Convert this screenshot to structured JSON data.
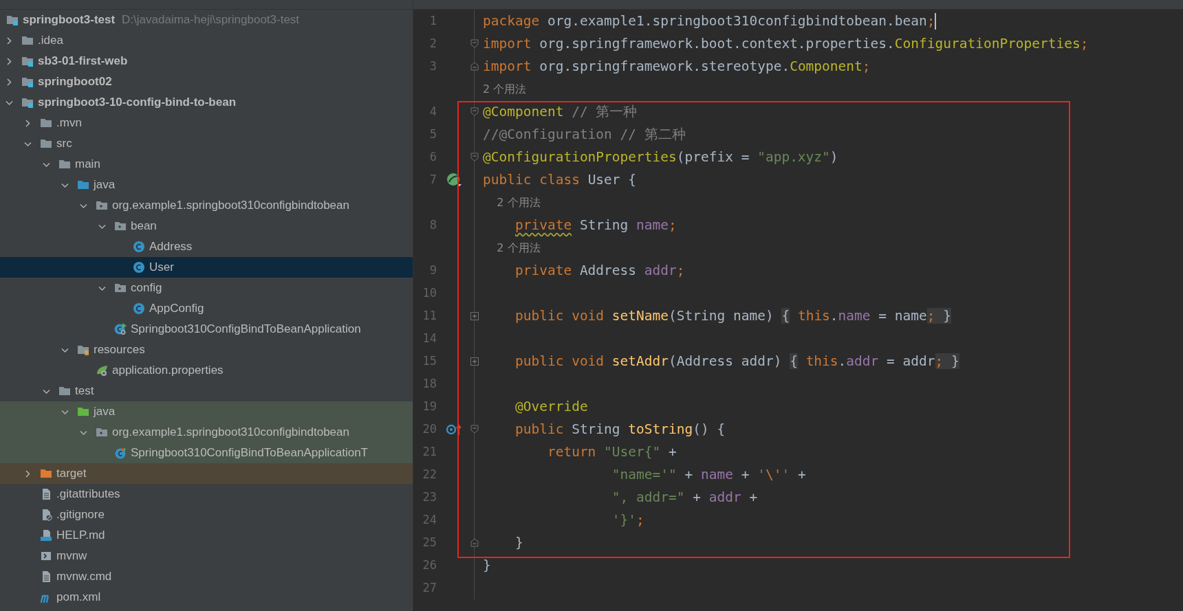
{
  "project_tree": {
    "label": "springboot3-test",
    "path": "D:\\javadaima-heji\\springboot3-test",
    "selected": false,
    "children": [
      {
        "label": ".idea",
        "kind": "folder",
        "expanded": false,
        "selected": false
      },
      {
        "label": "sb3-01-first-web",
        "kind": "module",
        "expanded": false,
        "selected": false
      },
      {
        "label": "springboot02",
        "kind": "module",
        "expanded": false,
        "selected": false
      },
      {
        "label": "springboot3-10-config-bind-to-bean",
        "kind": "module",
        "expanded": true,
        "selected": false,
        "children": [
          {
            "label": ".mvn",
            "kind": "folder",
            "expanded": false,
            "selected": false
          },
          {
            "label": "src",
            "kind": "folder",
            "expanded": true,
            "selected": false,
            "children": [
              {
                "label": "main",
                "kind": "folder",
                "expanded": true,
                "selected": false,
                "children": [
                  {
                    "label": "java",
                    "kind": "source",
                    "expanded": true,
                    "selected": false,
                    "children": [
                      {
                        "label": "org.example1.springboot310configbindtobean",
                        "kind": "package",
                        "expanded": true,
                        "selected": false,
                        "children": [
                          {
                            "label": "bean",
                            "kind": "package",
                            "expanded": true,
                            "selected": false,
                            "children": [
                              {
                                "label": "Address",
                                "kind": "class",
                                "selected": false
                              },
                              {
                                "label": "User",
                                "kind": "class",
                                "selected": true
                              }
                            ]
                          },
                          {
                            "label": "config",
                            "kind": "package",
                            "expanded": true,
                            "selected": false,
                            "children": [
                              {
                                "label": "AppConfig",
                                "kind": "class",
                                "selected": false
                              }
                            ]
                          },
                          {
                            "label": "Springboot310ConfigBindToBeanApplication",
                            "kind": "app",
                            "selected": false
                          }
                        ]
                      }
                    ]
                  },
                  {
                    "label": "resources",
                    "kind": "resources",
                    "expanded": true,
                    "selected": false,
                    "children": [
                      {
                        "label": "application.properties",
                        "kind": "properties",
                        "selected": false
                      }
                    ]
                  }
                ]
              },
              {
                "label": "test",
                "kind": "folder",
                "expanded": true,
                "selected": false,
                "children": [
                  {
                    "label": "java",
                    "kind": "test-source",
                    "test_scope": true,
                    "expanded": true,
                    "selected": false,
                    "children": [
                      {
                        "label": "org.example1.springboot310configbindtobean",
                        "kind": "package",
                        "test_scope": true,
                        "expanded": true,
                        "selected": false,
                        "children": [
                          {
                            "label": "Springboot310ConfigBindToBeanApplicationT",
                            "kind": "test-class",
                            "test_scope": true,
                            "selected": false
                          }
                        ]
                      }
                    ]
                  }
                ]
              }
            ]
          },
          {
            "label": "target",
            "kind": "target",
            "excluded": true,
            "expanded": false,
            "selected": false
          },
          {
            "label": ".gitattributes",
            "kind": "text",
            "selected": false
          },
          {
            "label": ".gitignore",
            "kind": "ignore",
            "selected": false
          },
          {
            "label": "HELP.md",
            "kind": "markdown",
            "selected": false
          },
          {
            "label": "mvnw",
            "kind": "script",
            "selected": false
          },
          {
            "label": "mvnw.cmd",
            "kind": "text",
            "selected": false
          },
          {
            "label": "pom.xml",
            "kind": "maven",
            "selected": false
          }
        ]
      }
    ]
  },
  "editor": {
    "lines": [
      {
        "kind": "code",
        "number": "1",
        "caret": true,
        "tokens": [
          {
            "kind": "kw",
            "text": "package"
          },
          {
            "kind": "plain",
            "text": " org.example1.springboot310configbindtobean.bean"
          },
          {
            "kind": "kw",
            "text": ";"
          }
        ]
      },
      {
        "kind": "code",
        "number": "2",
        "fold": {
          "kind": "open"
        },
        "tokens": [
          {
            "kind": "kw",
            "text": "import"
          },
          {
            "kind": "plain",
            "text": " org.springframework.boot.context.properties."
          },
          {
            "kind": "ann",
            "text": "ConfigurationProperties"
          },
          {
            "kind": "kw",
            "text": ";"
          }
        ]
      },
      {
        "kind": "code",
        "number": "3",
        "fold": {
          "kind": "end"
        },
        "tokens": [
          {
            "kind": "kw",
            "text": "import"
          },
          {
            "kind": "plain",
            "text": " org.springframework.stereotype."
          },
          {
            "kind": "ann",
            "text": "Component"
          },
          {
            "kind": "kw",
            "text": ";"
          }
        ]
      },
      {
        "kind": "hint",
        "text": "2 个用法"
      },
      {
        "kind": "code",
        "number": "4",
        "fold": {
          "kind": "open"
        },
        "tokens": [
          {
            "kind": "ann",
            "text": "@Component"
          },
          {
            "kind": "comment",
            "text": " // 第一种"
          }
        ]
      },
      {
        "kind": "code",
        "number": "5",
        "tokens": [
          {
            "kind": "comment",
            "text": "//@Configuration // 第二种"
          }
        ]
      },
      {
        "kind": "code",
        "number": "6",
        "fold": {
          "kind": "open"
        },
        "tokens": [
          {
            "kind": "ann",
            "text": "@ConfigurationProperties"
          },
          {
            "kind": "plain",
            "text": "(prefix = "
          },
          {
            "kind": "str",
            "text": "\"app.xyz\""
          },
          {
            "kind": "plain",
            "text": ")"
          }
        ]
      },
      {
        "kind": "code",
        "number": "7",
        "marker": {
          "kind": "bean"
        },
        "tokens": [
          {
            "kind": "kw",
            "text": "public class "
          },
          {
            "kind": "plain",
            "text": "User {"
          }
        ]
      },
      {
        "kind": "hint",
        "text": "    2 个用法"
      },
      {
        "kind": "code",
        "number": "8",
        "tokens": [
          {
            "kind": "kw-warn",
            "text": "    private"
          },
          {
            "kind": "plain",
            "text": " String "
          },
          {
            "kind": "field",
            "text": "name"
          },
          {
            "kind": "kw",
            "text": ";"
          }
        ]
      },
      {
        "kind": "hint",
        "text": "    2 个用法"
      },
      {
        "kind": "code",
        "number": "9",
        "tokens": [
          {
            "kind": "kw",
            "text": "    private"
          },
          {
            "kind": "plain",
            "text": " Address "
          },
          {
            "kind": "field",
            "text": "addr"
          },
          {
            "kind": "kw",
            "text": ";"
          }
        ]
      },
      {
        "kind": "code",
        "number": "10"
      },
      {
        "kind": "code",
        "number": "11",
        "fold": {
          "kind": "collapsed"
        },
        "tokens": [
          {
            "kind": "kw",
            "text": "    public void "
          },
          {
            "kind": "method",
            "text": "setName"
          },
          {
            "kind": "plain",
            "text": "(String name) "
          },
          {
            "kind": "fold",
            "text": "{"
          },
          {
            "kind": "kw",
            "text": " this"
          },
          {
            "kind": "plain",
            "text": "."
          },
          {
            "kind": "field",
            "text": "name"
          },
          {
            "kind": "plain",
            "text": " = name"
          },
          {
            "kind": "fold-kw",
            "text": ";"
          },
          {
            "kind": "fold",
            "text": " }"
          }
        ]
      },
      {
        "kind": "code",
        "number": "14"
      },
      {
        "kind": "code",
        "number": "15",
        "fold": {
          "kind": "collapsed"
        },
        "tokens": [
          {
            "kind": "kw",
            "text": "    public void "
          },
          {
            "kind": "method",
            "text": "setAddr"
          },
          {
            "kind": "plain",
            "text": "(Address addr) "
          },
          {
            "kind": "fold",
            "text": "{"
          },
          {
            "kind": "kw",
            "text": " this"
          },
          {
            "kind": "plain",
            "text": "."
          },
          {
            "kind": "field",
            "text": "addr"
          },
          {
            "kind": "plain",
            "text": " = addr"
          },
          {
            "kind": "fold-kw",
            "text": ";"
          },
          {
            "kind": "fold",
            "text": " }"
          }
        ]
      },
      {
        "kind": "code",
        "number": "18"
      },
      {
        "kind": "code",
        "number": "19",
        "tokens": [
          {
            "kind": "ann",
            "text": "    @Override"
          }
        ]
      },
      {
        "kind": "code",
        "number": "20",
        "marker": {
          "kind": "override"
        },
        "fold": {
          "kind": "open"
        },
        "tokens": [
          {
            "kind": "kw",
            "text": "    public "
          },
          {
            "kind": "plain",
            "text": "String "
          },
          {
            "kind": "method",
            "text": "toString"
          },
          {
            "kind": "plain",
            "text": "() {"
          }
        ]
      },
      {
        "kind": "code",
        "number": "21",
        "tokens": [
          {
            "kind": "kw",
            "text": "        return "
          },
          {
            "kind": "str",
            "text": "\"User{\""
          },
          {
            "kind": "plain",
            "text": " +"
          }
        ]
      },
      {
        "kind": "code",
        "number": "22",
        "tokens": [
          {
            "kind": "str",
            "text": "                \"name='\""
          },
          {
            "kind": "plain",
            "text": " + "
          },
          {
            "kind": "field",
            "text": "name"
          },
          {
            "kind": "plain",
            "text": " + "
          },
          {
            "kind": "str",
            "text": "'"
          },
          {
            "kind": "kw",
            "text": "\\'"
          },
          {
            "kind": "str",
            "text": "'"
          },
          {
            "kind": "plain",
            "text": " +"
          }
        ]
      },
      {
        "kind": "code",
        "number": "23",
        "tokens": [
          {
            "kind": "str",
            "text": "                \", addr=\""
          },
          {
            "kind": "plain",
            "text": " + "
          },
          {
            "kind": "field",
            "text": "addr"
          },
          {
            "kind": "plain",
            "text": " +"
          }
        ]
      },
      {
        "kind": "code",
        "number": "24",
        "tokens": [
          {
            "kind": "str",
            "text": "                '}'"
          },
          {
            "kind": "kw",
            "text": ";"
          }
        ]
      },
      {
        "kind": "code",
        "number": "25",
        "fold": {
          "kind": "end"
        },
        "tokens": [
          {
            "kind": "plain",
            "text": "    }"
          }
        ]
      },
      {
        "kind": "code",
        "number": "26",
        "tokens": [
          {
            "kind": "plain",
            "text": "}"
          }
        ]
      },
      {
        "kind": "code",
        "number": "27"
      }
    ]
  }
}
